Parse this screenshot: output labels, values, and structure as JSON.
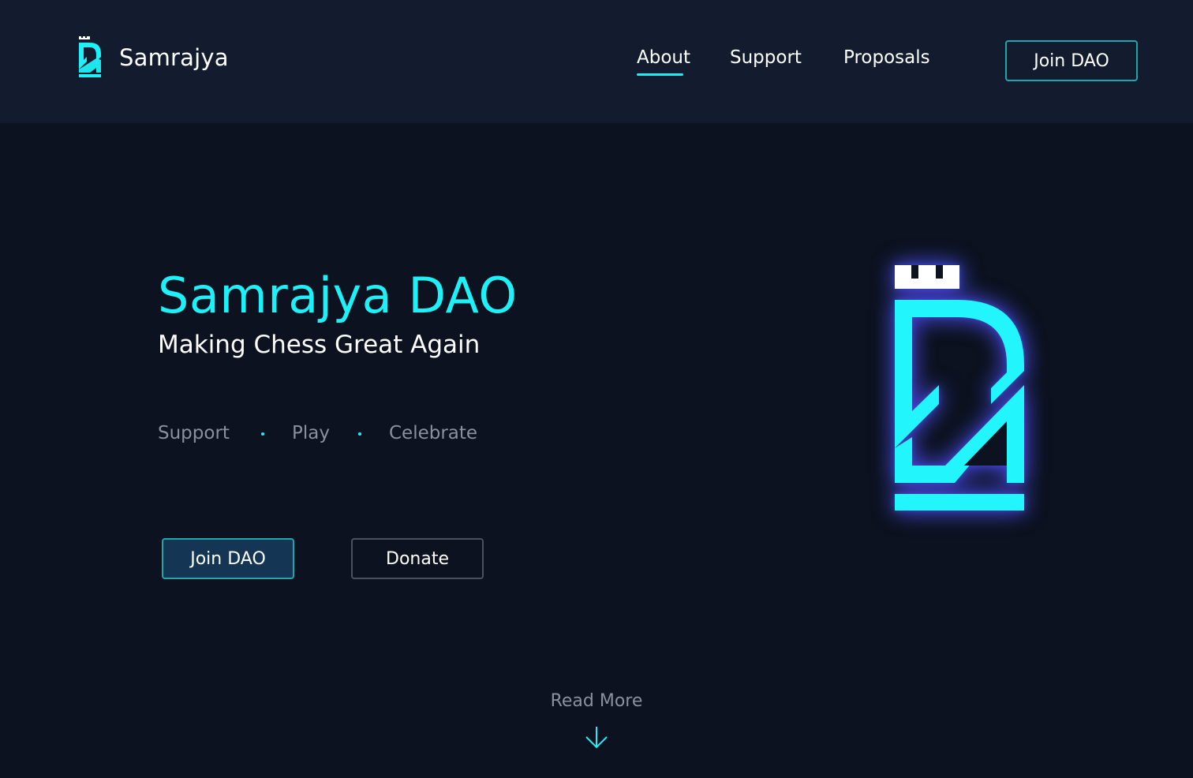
{
  "header": {
    "brand_name": "Samrajya",
    "logo_icon": "rook-logo-icon",
    "nav": [
      {
        "label": "About",
        "active": true
      },
      {
        "label": "Support",
        "active": false
      },
      {
        "label": "Proposals",
        "active": false
      }
    ],
    "cta_label": "Join DAO"
  },
  "hero": {
    "title": "Samrajya DAO",
    "subtitle": "Making Chess Great Again",
    "tags": [
      "Support",
      "Play",
      "Celebrate"
    ],
    "primary_button": "Join DAO",
    "secondary_button": "Donate",
    "logo_icon": "rook-logo-icon"
  },
  "read_more": {
    "label": "Read More",
    "icon": "arrow-down-icon"
  },
  "colors": {
    "background": "#0c121f",
    "header_background": "#121c2e",
    "accent": "#1ef0f7",
    "button_border": "#1fa6ad",
    "primary_button_fill": "#153555",
    "muted_text": "#8a919c",
    "logo_glow": "#5a3cff"
  }
}
